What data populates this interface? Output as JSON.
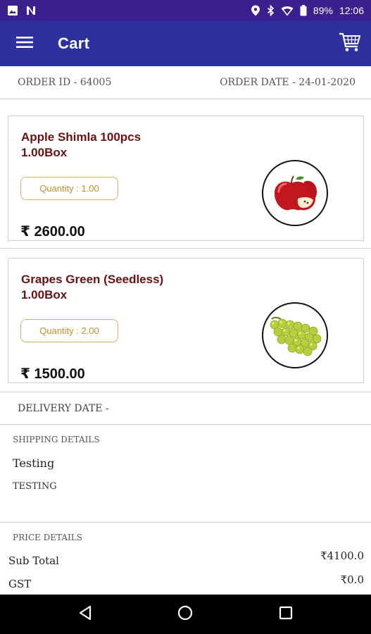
{
  "status_bar": {
    "battery": "89%",
    "time": "12:06",
    "icons": [
      "image-icon",
      "n-icon",
      "location-icon",
      "bluetooth-icon",
      "wifi-icon",
      "battery-icon"
    ]
  },
  "app_bar": {
    "title": "Cart",
    "icons": [
      "menu-icon",
      "cart-icon"
    ],
    "color": "#2e309d"
  },
  "order": {
    "id_text": "ORDER ID - 64005",
    "date_text": "ORDER DATE - 24-01-2020"
  },
  "items": [
    {
      "name": "Apple Shimla 100pcs",
      "unit": "1.00Box",
      "quantity": "Quantity : 1.00",
      "price": "₹ 2600.00",
      "image_icon": "apple-image"
    },
    {
      "name": "Grapes Green (Seedless)",
      "unit": "1.00Box",
      "quantity": "Quantity : 2.00",
      "price": "₹ 1500.00",
      "image_icon": "grapes-image"
    }
  ],
  "delivery": {
    "label": "DELIVERY DATE -"
  },
  "shipping": {
    "heading": "SHIPPING DETAILS",
    "name": "Testing",
    "address": "TESTING"
  },
  "price_details": {
    "heading": "PRICE DETAILS",
    "rows": [
      {
        "label": "Sub Total",
        "value": "₹4100.0"
      },
      {
        "label": "GST",
        "value": "₹0.0"
      }
    ]
  },
  "nav_bar": {
    "icons": [
      "back-icon",
      "home-icon",
      "recents-icon"
    ]
  },
  "colors": {
    "status_bar": "#3a1f8f",
    "item_name": "#6b1111",
    "quantity_border": "#d9b266",
    "quantity_text": "#c29027"
  }
}
